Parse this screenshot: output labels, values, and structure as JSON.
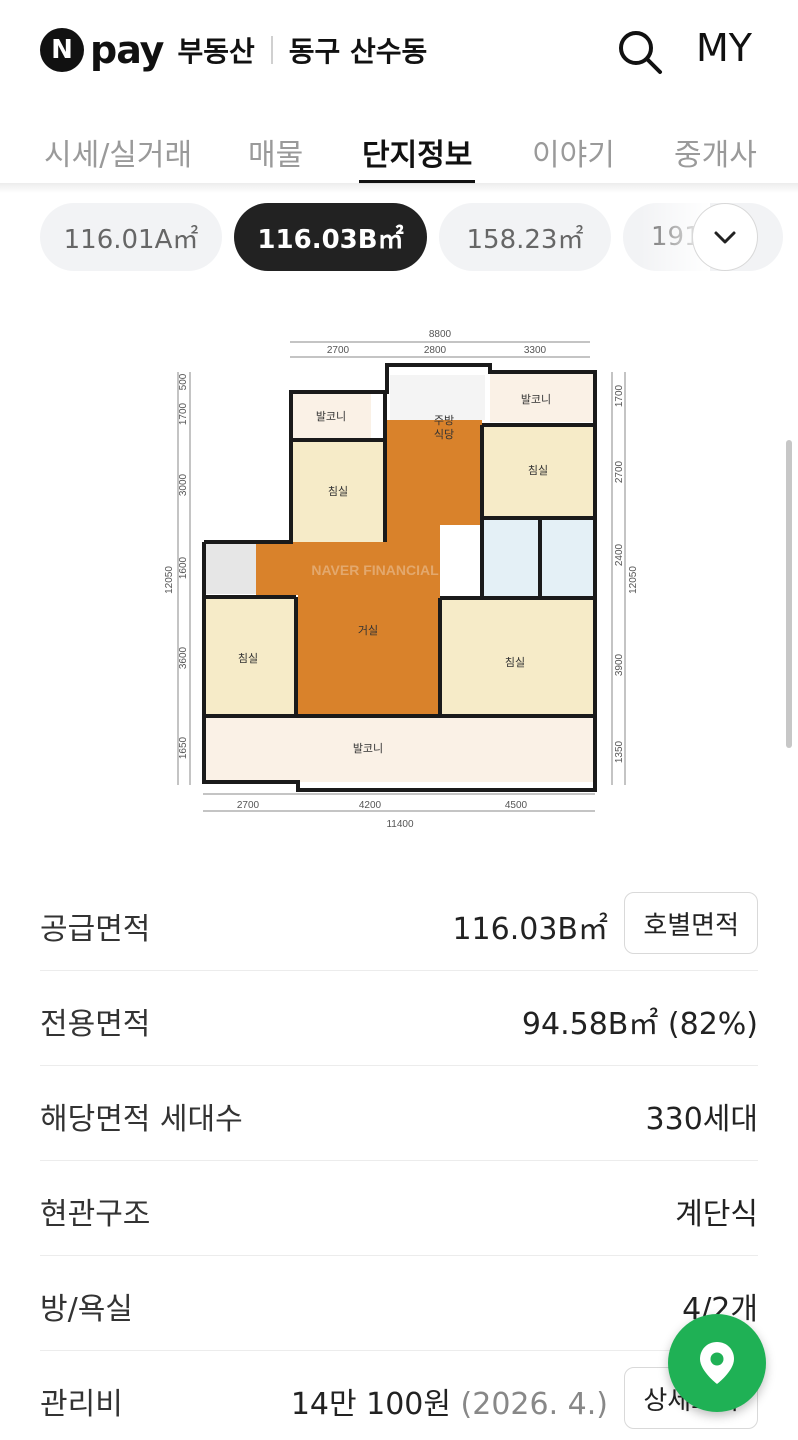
{
  "header": {
    "logo_letter": "N",
    "brand": "pay",
    "service": "부동산",
    "region": "동구 산수동",
    "my_label": "MY"
  },
  "tabs": [
    {
      "label": "시세/실거래",
      "active": false
    },
    {
      "label": "매물",
      "active": false
    },
    {
      "label": "단지정보",
      "active": true
    },
    {
      "label": "이야기",
      "active": false
    },
    {
      "label": "중개사",
      "active": false
    }
  ],
  "area_chips": [
    {
      "label": "116.01A㎡",
      "selected": false
    },
    {
      "label": "116.03B㎡",
      "selected": true
    },
    {
      "label": "158.23㎡",
      "selected": false
    },
    {
      "label": "191",
      "selected": false
    }
  ],
  "floorplan": {
    "dimensions_top": [
      "8800",
      "2700",
      "2800",
      "3300"
    ],
    "dimensions_bottom": [
      "2700",
      "4200",
      "4500",
      "11400"
    ],
    "dimensions_left": [
      "500",
      "1700",
      "3000",
      "1600",
      "3600",
      "1650",
      "12050"
    ],
    "dimensions_right": [
      "1700",
      "2700",
      "2400",
      "3900",
      "1350",
      "12050"
    ],
    "rooms": {
      "balcony_top_left": "발코니",
      "kitchen_line1": "주방",
      "kitchen_line2": "식당",
      "balcony_top_right": "발코니",
      "bedroom_top_left": "침실",
      "bedroom_top_right": "침실",
      "living": "거실",
      "bedroom_left": "침실",
      "bedroom_master": "침실",
      "balcony_bottom": "발코니"
    },
    "watermark": "NAVER FINANCIAL"
  },
  "info": {
    "supply_area": {
      "label": "공급면적",
      "value": "116.03B㎡",
      "button": "호별면적"
    },
    "exclusive_area": {
      "label": "전용면적",
      "value": "94.58B㎡ (82%)"
    },
    "households": {
      "label": "해당면적 세대수",
      "value": "330세대"
    },
    "entrance": {
      "label": "현관구조",
      "value": "계단식"
    },
    "rooms_baths": {
      "label": "방/욕실",
      "value": "4/2개"
    },
    "maintenance": {
      "label": "관리비",
      "value": "14만 100원",
      "date": "(2026. 4.)",
      "button": "상세보기"
    }
  },
  "colors": {
    "accent_dark": "#222222",
    "fab_green": "#1fb155",
    "floor_wood": "#d9822b"
  }
}
